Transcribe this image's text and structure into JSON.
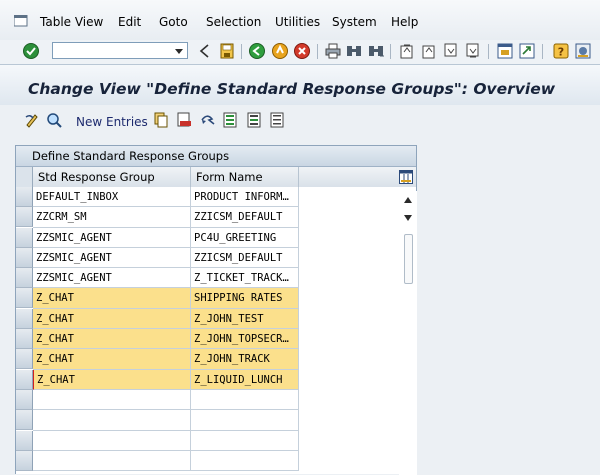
{
  "menu": {
    "items": [
      "Table View",
      "Edit",
      "Goto",
      "Selection",
      "Utilities",
      "System",
      "Help"
    ]
  },
  "toolbar": {
    "command_value": ""
  },
  "title": "Change View \"Define Standard Response Groups\": Overview",
  "app_toolbar": {
    "new_entries_label": "New Entries"
  },
  "table": {
    "title": "Define Standard Response Groups",
    "columns": [
      "Std Response Group",
      "Form Name"
    ],
    "rows": [
      {
        "group": "DEFAULT_INBOX",
        "form": "PRODUCT INFORM…",
        "highlight": false
      },
      {
        "group": "ZZCRM_SM",
        "form": "ZZICSM_DEFAULT",
        "highlight": false
      },
      {
        "group": "ZZSMIC_AGENT",
        "form": "PC4U_GREETING",
        "highlight": false
      },
      {
        "group": "ZZSMIC_AGENT",
        "form": "ZZICSM_DEFAULT",
        "highlight": false
      },
      {
        "group": "ZZSMIC_AGENT",
        "form": "Z_TICKET_TRACK…",
        "highlight": false
      },
      {
        "group": "Z_CHAT",
        "form": "SHIPPING RATES",
        "highlight": true
      },
      {
        "group": "Z_CHAT",
        "form": "Z_JOHN_TEST",
        "highlight": true
      },
      {
        "group": "Z_CHAT",
        "form": "Z_JOHN_TOPSECR…",
        "highlight": true
      },
      {
        "group": "Z_CHAT",
        "form": "Z_JOHN_TRACK",
        "highlight": true
      },
      {
        "group": "Z_CHAT",
        "form": "Z_LIQUID_LUNCH",
        "highlight": true
      },
      {
        "group": "",
        "form": "",
        "highlight": false
      },
      {
        "group": "",
        "form": "",
        "highlight": false
      },
      {
        "group": "",
        "form": "",
        "highlight": false
      },
      {
        "group": "",
        "form": "",
        "highlight": false
      }
    ],
    "highlight_color": "#fbe08c"
  },
  "icons": {
    "toolbar": [
      "enter-icon",
      "back-icon",
      "save-icon",
      "back-nav-icon",
      "exit-icon",
      "cancel-icon",
      "print-icon",
      "find-icon",
      "find-next-icon",
      "first-page-icon",
      "prev-page-icon",
      "next-page-icon",
      "last-page-icon",
      "create-session-icon",
      "shortcut-icon",
      "help-icon",
      "customize-layout-icon"
    ],
    "app_toolbar": [
      "change-display-icon",
      "details-icon",
      "copy-as-icon",
      "delete-icon",
      "undo-change-icon",
      "select-all-icon",
      "select-block-icon",
      "deselect-all-icon"
    ]
  }
}
